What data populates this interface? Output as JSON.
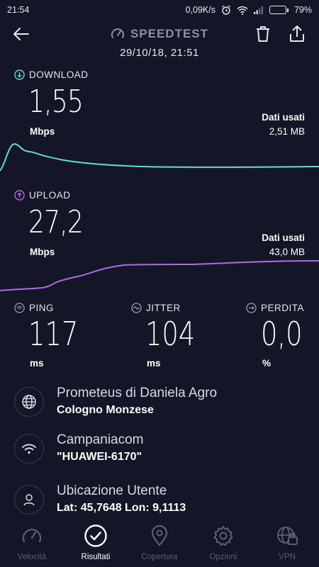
{
  "status_bar": {
    "time": "21:54",
    "net_speed": "0,09K/s",
    "battery_percent": "79%",
    "battery_level": 0.79
  },
  "header": {
    "title": "SPEEDTEST",
    "date": "29/10/18, 21:51"
  },
  "download": {
    "label": "DOWNLOAD",
    "value": "1,55",
    "unit": "Mbps",
    "data_used_label": "Dati usati",
    "data_used_value": "2,51 MB",
    "color": "#5fe0d2"
  },
  "upload": {
    "label": "UPLOAD",
    "value": "27,2",
    "unit": "Mbps",
    "data_used_label": "Dati usati",
    "data_used_value": "43,0 MB",
    "color": "#b06ae8"
  },
  "ping": {
    "label": "PING",
    "value": "117",
    "unit": "ms"
  },
  "jitter": {
    "label": "JITTER",
    "value": "104",
    "unit": "ms"
  },
  "loss": {
    "label": "PERDITA",
    "value": "0,0",
    "unit": "%"
  },
  "server": {
    "name": "Prometeus di Daniela Agro",
    "location": "Cologno Monzese",
    "icon": "globe-icon"
  },
  "provider": {
    "name": "Campaniacom",
    "network": "\"HUAWEI-6170\"",
    "icon": "wifi-icon"
  },
  "user_location": {
    "label": "Ubicazione Utente",
    "coords": "Lat: 45,7648 Lon: 9,1113",
    "icon": "user-icon"
  },
  "nav": {
    "items": [
      {
        "label": "Velocità",
        "icon": "speedometer-icon"
      },
      {
        "label": "Risultati",
        "icon": "check-circle-icon",
        "active": true
      },
      {
        "label": "Copertura",
        "icon": "map-pin-icon"
      },
      {
        "label": "Opzioni",
        "icon": "gear-icon"
      },
      {
        "label": "VPN",
        "icon": "vpn-globe-icon"
      }
    ]
  },
  "colors": {
    "background": "#141526",
    "muted": "#5c5e74"
  }
}
